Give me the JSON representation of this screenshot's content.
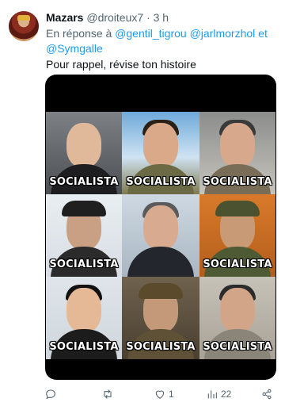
{
  "tweet": {
    "author_name": "Mazars",
    "author_handle": "@droiteux7",
    "separator": "·",
    "time": "3 h",
    "reply_prefix": "En réponse à",
    "mentions": [
      "@gentil_tigrou",
      "@jarlmorzhol",
      "et",
      "@Symgalle"
    ],
    "text": "Pour rappel, révise ton histoire"
  },
  "media": {
    "labels": [
      "SOCIALISTA",
      "SOCIALISTA",
      "SOCIALISTA",
      "SOCIALISTA",
      "SOCIALISTA",
      "SOCIALISTA",
      "SOCIALISTA",
      "SOCIALISTA"
    ]
  },
  "actions": {
    "reply_icon": "reply-icon",
    "retweet_icon": "retweet-icon",
    "like_icon": "heart-icon",
    "like_count": "1",
    "views_icon": "views-icon",
    "views_count": "22",
    "share_icon": "share-icon"
  },
  "colors": {
    "link": "#1d9bf0",
    "secondary_text": "#536471",
    "primary_text": "#0f1419"
  }
}
